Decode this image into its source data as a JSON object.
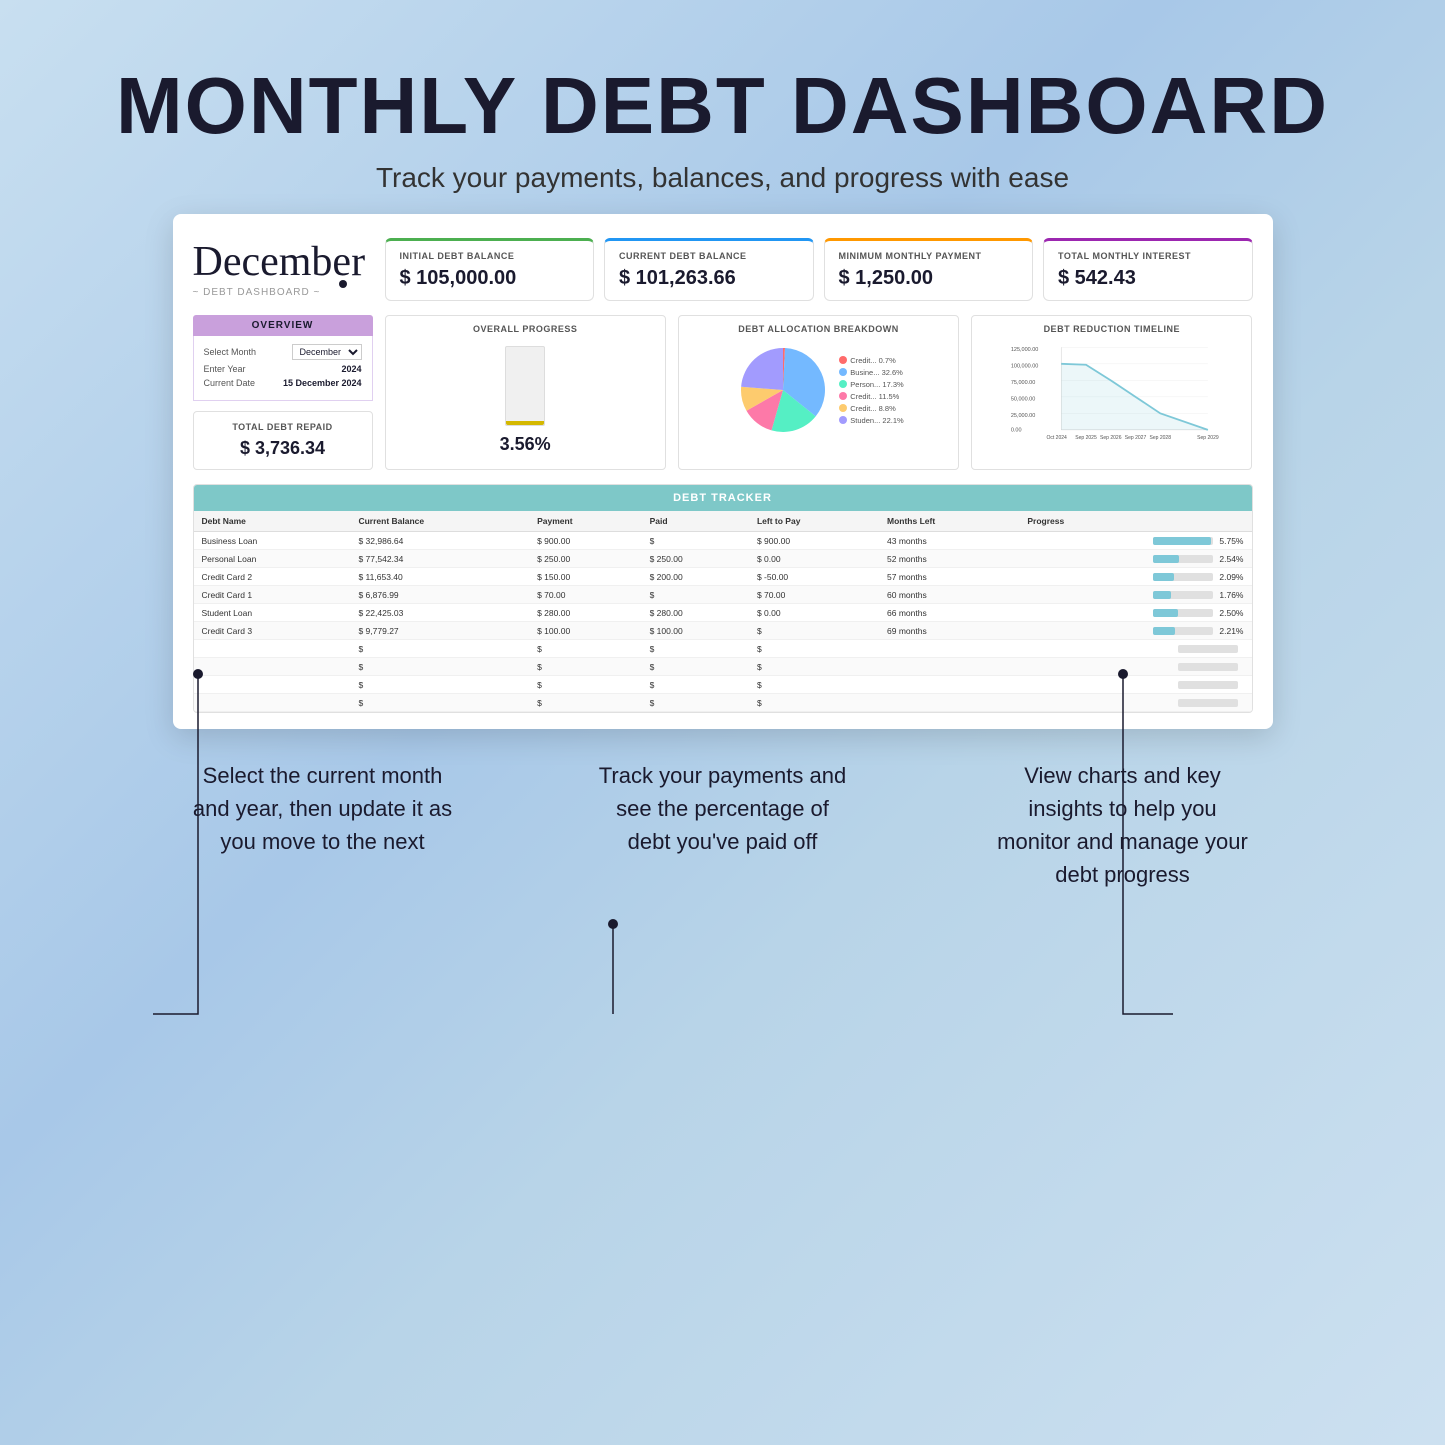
{
  "page": {
    "title": "MONTHLY DEBT DASHBOARD",
    "subtitle": "Track your payments, balances, and progress with ease"
  },
  "header": {
    "month": "December",
    "dashboard_label": "~ DEBT DASHBOARD ~"
  },
  "kpis": [
    {
      "label": "INITIAL DEBT BALANCE",
      "value": "$ 105,000.00",
      "border_color": "green-border"
    },
    {
      "label": "CURRENT DEBT BALANCE",
      "value": "$ 101,263.66",
      "border_color": "blue-border"
    },
    {
      "label": "MINIMUM MONTHLY PAYMENT",
      "value": "$ 1,250.00",
      "border_color": "orange-border"
    },
    {
      "label": "TOTAL MONTHLY INTEREST",
      "value": "$ 542.43",
      "border_color": "purple-border"
    }
  ],
  "overview": {
    "title": "OVERVIEW",
    "select_month_label": "Select Month",
    "select_month_value": "December",
    "enter_year_label": "Enter Year",
    "enter_year_value": "2024",
    "current_date_label": "Current Date",
    "current_date_value": "15 December 2024",
    "total_repaid_label": "TOTAL DEBT REPAID",
    "total_repaid_value": "$ 3,736.34"
  },
  "overall_progress": {
    "title": "OVERALL PROGRESS",
    "percent": "3.56%",
    "fill_height_pct": 3.56
  },
  "debt_allocation": {
    "title": "DEBT ALLOCATION BREAKDOWN",
    "segments": [
      {
        "label": "Credit...\n0.7%",
        "value": 0.7,
        "color": "#ff6b6b"
      },
      {
        "label": "Busine...\n32.6%",
        "value": 32.6,
        "color": "#74b9ff"
      },
      {
        "label": "Person...\n17.3%",
        "value": 17.3,
        "color": "#55efc4"
      },
      {
        "label": "Credit...\n11.5%",
        "value": 11.5,
        "color": "#fd79a8"
      },
      {
        "label": "Credit...\n8.8%",
        "value": 8.8,
        "color": "#fdcb6e"
      },
      {
        "label": "Studen...\n22.1%",
        "value": 22.1,
        "color": "#a29bfe"
      }
    ],
    "legend": [
      {
        "label": "Credit... 0.7%",
        "color": "#ff6b6b"
      },
      {
        "label": "Busine... 32.6%",
        "color": "#74b9ff"
      },
      {
        "label": "Person... 17.3%",
        "color": "#55efc4"
      },
      {
        "label": "Credit... 11.5%",
        "color": "#fd79a8"
      },
      {
        "label": "Credit... 8.8%",
        "color": "#fdcb6e"
      },
      {
        "label": "Studen... 22.1%",
        "color": "#a29bfe"
      }
    ]
  },
  "debt_reduction": {
    "title": "DEBT REDUCTION TIMELINE",
    "y_labels": [
      "125,000.00",
      "100,000.00",
      "75,000.00",
      "50,000.00",
      "25,000.00",
      "0.00"
    ],
    "x_labels": [
      "Oct 2024",
      "Sep 2025",
      "Sep 2026",
      "Sep 2027",
      "Sep 2028",
      "Sep 2029"
    ]
  },
  "debt_tracker": {
    "title": "DEBT TRACKER",
    "columns": [
      "Debt Name",
      "Current Balance",
      "Payment",
      "Paid",
      "Left to Pay",
      "Months Left",
      "Progress"
    ],
    "rows": [
      {
        "name": "Business Loan",
        "balance": "$ 32,986.64",
        "payment": "$ 900.00",
        "paid": "$",
        "left_to_pay": "$ 900.00",
        "months": "43 months",
        "progress": 5.75
      },
      {
        "name": "Personal Loan",
        "balance": "$ 77,542.34",
        "payment": "$ 250.00",
        "paid": "$ 250.00",
        "left_to_pay": "$ 0.00",
        "months": "52 months",
        "progress": 2.54
      },
      {
        "name": "Credit Card 2",
        "balance": "$ 11,653.40",
        "payment": "$ 150.00",
        "paid": "$ 200.00",
        "left_to_pay": "$ -50.00",
        "months": "57 months",
        "progress": 2.09
      },
      {
        "name": "Credit Card 1",
        "balance": "$ 6,876.99",
        "payment": "$ 70.00",
        "paid": "$",
        "left_to_pay": "$ 70.00",
        "months": "60 months",
        "progress": 1.76
      },
      {
        "name": "Student Loan",
        "balance": "$ 22,425.03",
        "payment": "$ 280.00",
        "paid": "$ 280.00",
        "left_to_pay": "$ 0.00",
        "months": "66 months",
        "progress": 2.5
      },
      {
        "name": "Credit Card 3",
        "balance": "$ 9,779.27",
        "payment": "$ 100.00",
        "paid": "$ 100.00",
        "left_to_pay": "$",
        "months": "69 months",
        "progress": 2.21
      },
      {
        "name": "",
        "balance": "$",
        "payment": "$",
        "paid": "$",
        "left_to_pay": "$",
        "months": "",
        "progress": 0
      },
      {
        "name": "",
        "balance": "$",
        "payment": "$",
        "paid": "$",
        "left_to_pay": "$",
        "months": "",
        "progress": 0
      },
      {
        "name": "",
        "balance": "$",
        "payment": "$",
        "paid": "$",
        "left_to_pay": "$",
        "months": "",
        "progress": 0
      },
      {
        "name": "",
        "balance": "$",
        "payment": "$",
        "paid": "$",
        "left_to_pay": "$",
        "months": "",
        "progress": 0
      }
    ]
  },
  "annotations": [
    {
      "text": "Select the current month and year, then update it as you move to the next",
      "position": "left"
    },
    {
      "text": "Track your payments and see the percentage of debt you've paid off",
      "position": "center"
    },
    {
      "text": "View charts and key insights to help you monitor and manage your debt progress",
      "position": "right"
    }
  ]
}
